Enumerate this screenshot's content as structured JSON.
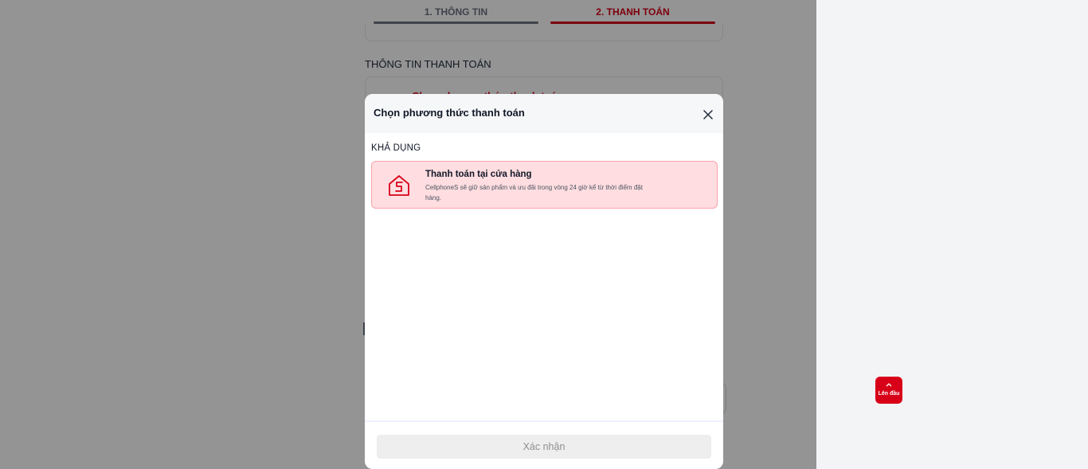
{
  "steps": {
    "info_label": "1. THÔNG TIN",
    "payment_label": "2. THANH TOÁN"
  },
  "page": {
    "section_title": "THÔNG TIN THANH TOÁN",
    "payment_prompt": "Chọn phương thức thanh toán"
  },
  "modal": {
    "title": "Chọn phương thức thanh toán",
    "close_icon": "close-icon",
    "group_label": "KHẢ DỤNG",
    "options": [
      {
        "icon": "store-icon",
        "title": "Thanh toán tại cửa hàng",
        "description": "CellphoneS sẽ giữ sản phẩm và ưu đãi trong vòng 24 giờ kể từ thời điểm đặt hàng.",
        "selected": true
      }
    ],
    "confirm_label": "Xác nhận"
  },
  "back_to_top": {
    "icon": "chevron-up-icon",
    "label": "Lên đầu"
  },
  "colors": {
    "accent": "#d70018",
    "option_bg": "#ffdde0",
    "option_border": "#f7a3ab",
    "overlay": "rgba(0,0,0,0.42)"
  }
}
